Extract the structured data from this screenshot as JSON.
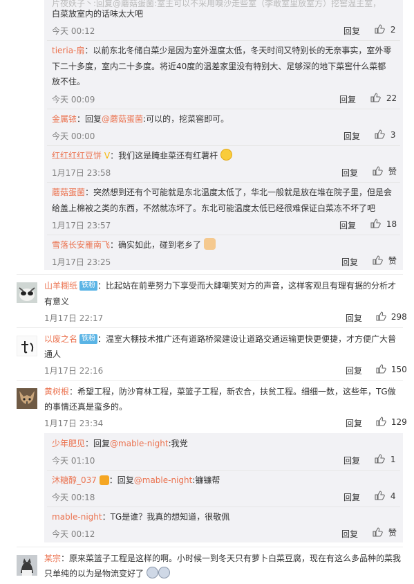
{
  "ui": {
    "reply": "回复",
    "like_default": "赞"
  },
  "top_reply_fragment": {
    "line1": "片夜妖子丶:回复@蘑菇蛋菌:室主可以不采用嗅沙走些室（李敢室里放室方）挖窖温主室，",
    "line2": "白菜放室内的话味太大吧",
    "time": "今天 00:12",
    "likes": "2"
  },
  "thread1_replies": [
    {
      "user": "tieria-扇",
      "text_a": "：以前东北冬储白菜少是因为室外温度太低，冬天时间又特别长的无奈事实，室外零",
      "text_b": "下二十多度，室内二十多度。将近40度的温差家里没有特别大、足够深的地下菜窖什么菜都",
      "text_c": "放不住。",
      "time": "今天 00:09",
      "likes": "22"
    },
    {
      "user": "金属铱",
      "prefix": "：回复",
      "mention": "@蘑菇蛋菌",
      "text": ":可以的，挖菜窖即可。",
      "time": "今天 00:00",
      "likes": "3"
    },
    {
      "user": "红红红红豆饼",
      "text": "：我们这是腌韭菜还有红薯杆",
      "time": "1月17日 23:58",
      "likes": "赞"
    },
    {
      "user": "蘑菇蛋菌",
      "text_a": "：突然想到还有个可能就是东北温度太低了，华北一般就是放在堆在院子里，但是会",
      "text_b": "给盖上棉被之类的东西，不然就冻坏了。东北可能温度太低已经很难保证白菜冻不坏了吧",
      "time": "1月17日 23:57",
      "likes": "18"
    },
    {
      "user": "雪落长安雁南飞",
      "text": "：确实如此，碰到老乡了",
      "time": "1月17日 23:25",
      "likes": "赞"
    }
  ],
  "comments": [
    {
      "user": "山羊糊纸",
      "badge": "铁粉",
      "text_a": "：比起站在前辈努力下享受而大肆嘲笑对方的声音，这样客观且有理有据的分析才",
      "text_b": "有意义",
      "time": "1月17日 22:17",
      "likes": "298"
    },
    {
      "user": "以废之名",
      "badge": "铁粉",
      "text_a": "：温室大棚技术推广还有道路桥梁建设让道路交通运输更快更便捷，才方便广大普",
      "text_b": "通人",
      "time": "1月17日 22:16",
      "likes": "150"
    },
    {
      "user": "黄树根",
      "text_a": "：希望工程，防沙育林工程，菜篮子工程，新农合，扶贫工程。细细一数，这些年，TG做",
      "text_b": "的事情还真是蛮多的。",
      "time": "1月17日 23:34",
      "likes": "129"
    },
    {
      "user": "某宗",
      "text_a": "：原来菜篮子工程是这样的啊。小时候一到冬天只有萝卜白菜豆腐，现在有这么多品种的菜我",
      "text_b": "只单纯的以为是物流变好了"
    }
  ],
  "thread2_replies": [
    {
      "user": "少年肥见",
      "prefix": "：回复",
      "mention": "@mable-night",
      "text": ":我党",
      "time": "今天 01:10",
      "likes": "1"
    },
    {
      "user": "沐糖醇_037",
      "prefix": "：回复",
      "mention": "@mable-night",
      "text": ":镰镰帮",
      "time": "今天 00:18",
      "likes": "4"
    },
    {
      "user": "mable-night",
      "text": "：TG是谁？我真的想知道，很敬佩",
      "time": "今天 00:12",
      "likes": "赞"
    }
  ]
}
